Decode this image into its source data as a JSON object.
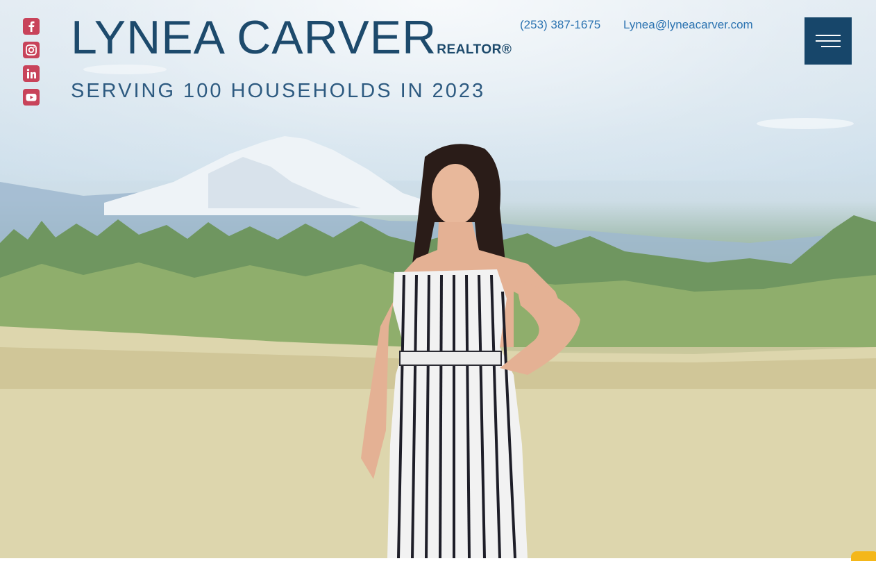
{
  "header": {
    "name": "LYNEA CARVER",
    "suffix": "REALTOR®",
    "tagline": "SERVING 100 HOUSEHOLDS IN 2023",
    "phone": "(253) 387-1675",
    "email": "Lynea@lyneacarver.com",
    "menu_icon": "hamburger-icon"
  },
  "social": [
    {
      "name": "facebook",
      "icon": "facebook-icon"
    },
    {
      "name": "instagram",
      "icon": "instagram-icon"
    },
    {
      "name": "linkedin",
      "icon": "linkedin-icon"
    },
    {
      "name": "youtube",
      "icon": "youtube-icon"
    }
  ],
  "colors": {
    "brand_navy": "#1d4a6c",
    "link_blue": "#2a72b0",
    "menu_bg": "#17466a",
    "social_red": "#c8435a",
    "chat_yellow": "#f4b71a"
  }
}
